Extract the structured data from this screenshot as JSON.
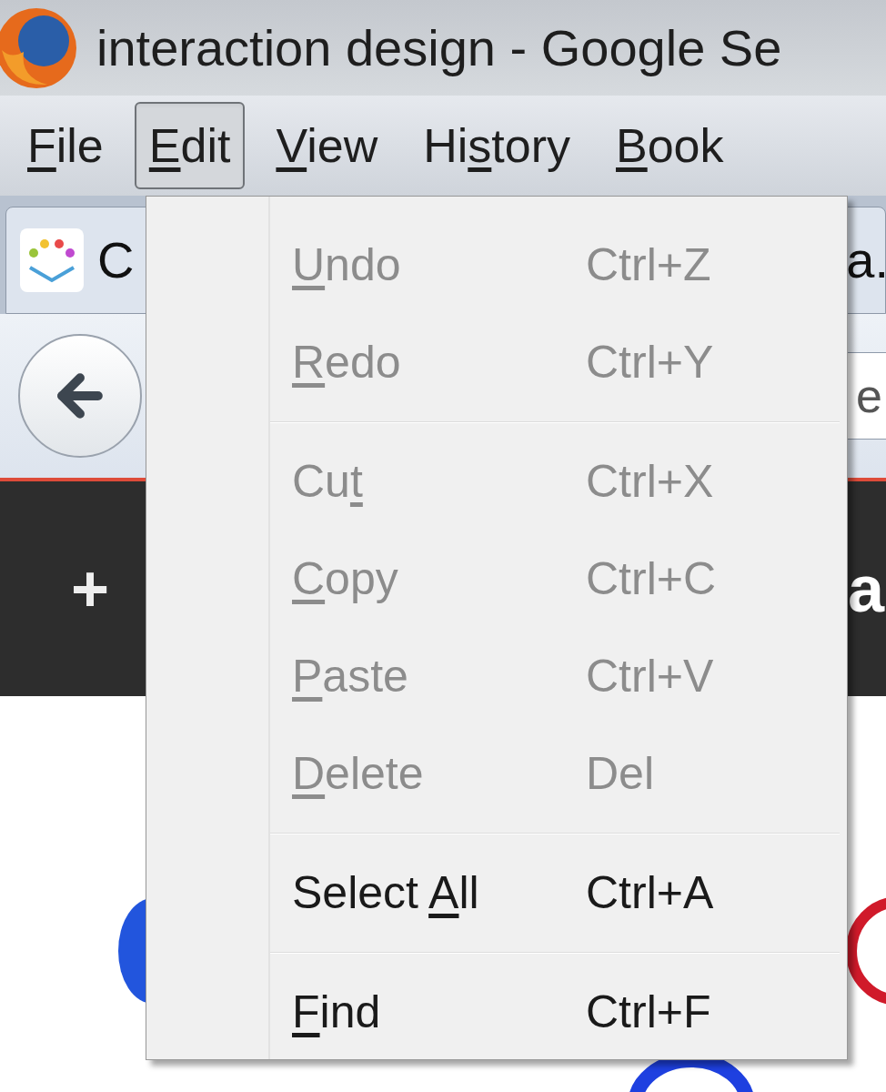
{
  "window": {
    "title": "interaction design - Google Se"
  },
  "menu_bar": [
    {
      "label": {
        "key": "F",
        "after": "ile"
      },
      "selected": false
    },
    {
      "label": {
        "key": "E",
        "after": "dit"
      },
      "selected": true
    },
    {
      "label": {
        "key": "V",
        "after": "iew"
      },
      "selected": false
    },
    {
      "label": {
        "before": "Hi",
        "key": "s",
        "after": "tory"
      },
      "selected": false
    },
    {
      "label": {
        "key": "B",
        "after": "ook"
      },
      "selected": false
    }
  ],
  "tabs": [
    {
      "label": "C"
    },
    {
      "label": "a."
    }
  ],
  "address_field": {
    "value": "e"
  },
  "google_bar": {
    "left_text": "+",
    "right_text": "a"
  },
  "edit_menu": [
    {
      "kind": "item",
      "label": {
        "key": "U",
        "after": "ndo"
      },
      "shortcut": "Ctrl+Z",
      "disabled": true
    },
    {
      "kind": "item",
      "label": {
        "key": "R",
        "after": "edo"
      },
      "shortcut": "Ctrl+Y",
      "disabled": true
    },
    {
      "kind": "separator"
    },
    {
      "kind": "item",
      "label": {
        "before": "Cu",
        "key": "t"
      },
      "shortcut": "Ctrl+X",
      "disabled": true
    },
    {
      "kind": "item",
      "label": {
        "key": "C",
        "after": "opy"
      },
      "shortcut": "Ctrl+C",
      "disabled": true
    },
    {
      "kind": "item",
      "label": {
        "key": "P",
        "after": "aste"
      },
      "shortcut": "Ctrl+V",
      "disabled": true
    },
    {
      "kind": "item",
      "label": {
        "key": "D",
        "after": "elete"
      },
      "shortcut": "Del",
      "disabled": true
    },
    {
      "kind": "separator"
    },
    {
      "kind": "item",
      "label": {
        "before": "Select ",
        "key": "A",
        "after": "ll"
      },
      "shortcut": "Ctrl+A",
      "disabled": false
    },
    {
      "kind": "separator"
    },
    {
      "kind": "item",
      "label": {
        "key": "F",
        "after": "ind"
      },
      "shortcut": "Ctrl+F",
      "disabled": false
    }
  ]
}
